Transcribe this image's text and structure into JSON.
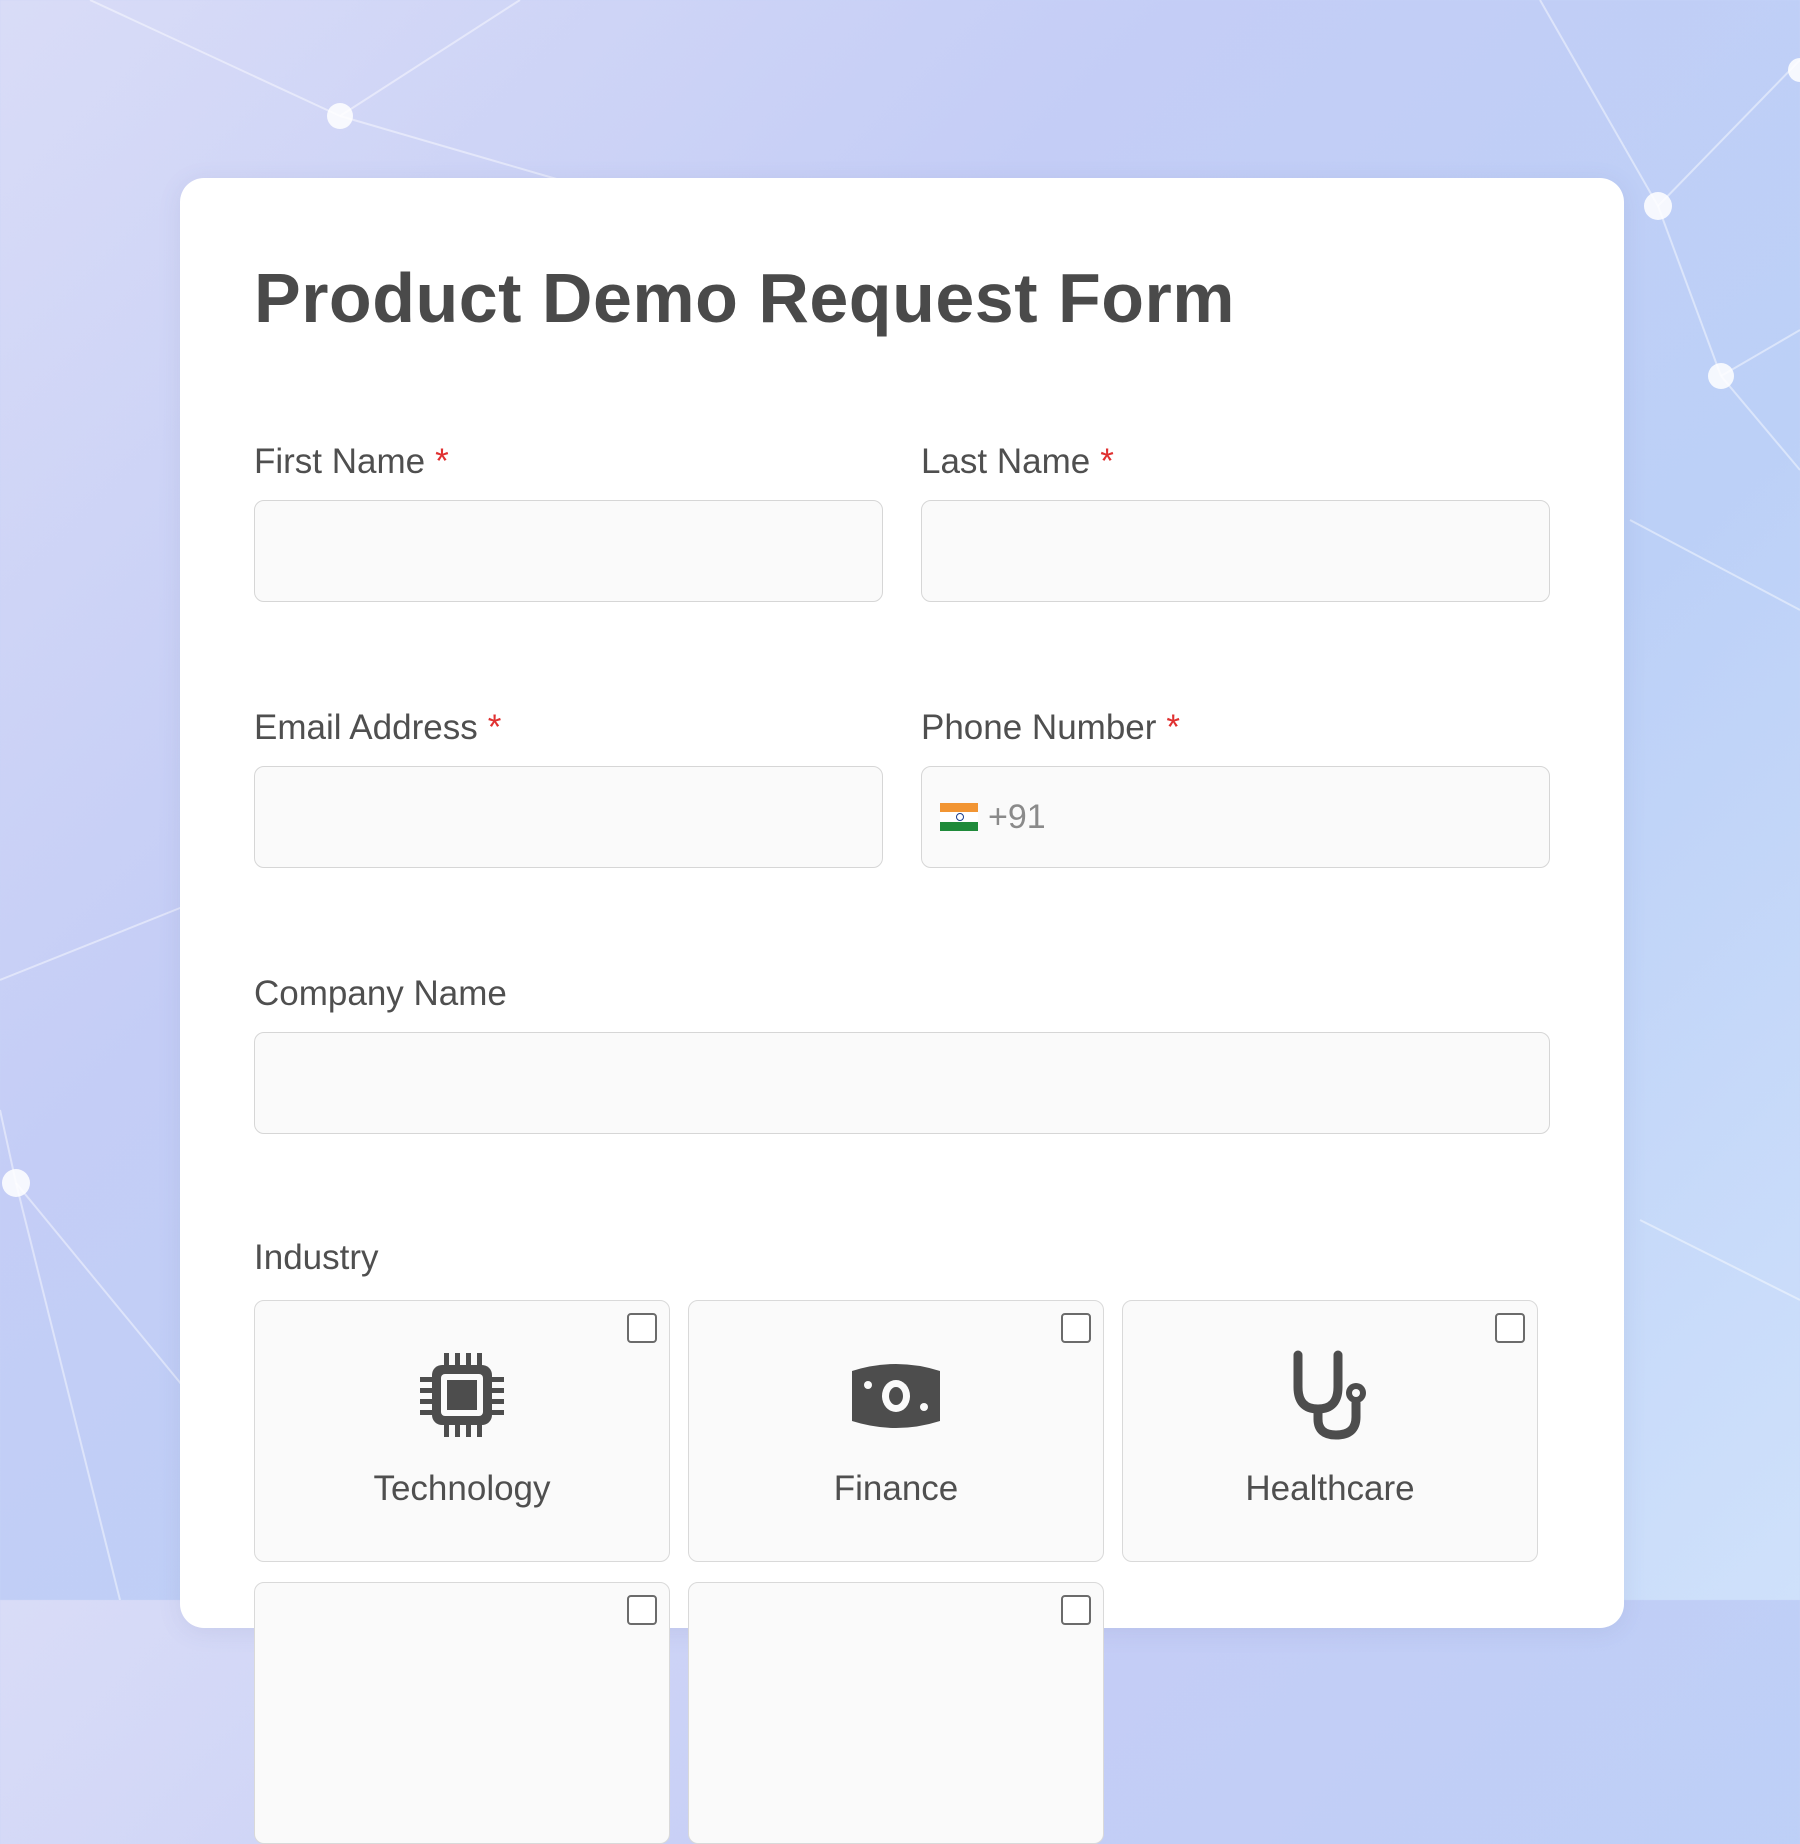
{
  "form": {
    "title": "Product Demo Request Form",
    "required_mark": "*",
    "fields": {
      "first_name": {
        "label": "First Name",
        "value": ""
      },
      "last_name": {
        "label": "Last Name",
        "value": ""
      },
      "email": {
        "label": "Email Address",
        "value": ""
      },
      "phone": {
        "label": "Phone Number",
        "country_flag": "india-flag-icon",
        "dial_code": "+91",
        "value": ""
      },
      "company": {
        "label": "Company Name",
        "value": ""
      }
    },
    "industry": {
      "label": "Industry",
      "options": [
        {
          "label": "Technology",
          "icon": "chip-icon",
          "checked": false
        },
        {
          "label": "Finance",
          "icon": "money-icon",
          "checked": false
        },
        {
          "label": "Healthcare",
          "icon": "stethoscope-icon",
          "checked": false
        }
      ]
    }
  },
  "colors": {
    "required": "#e03131",
    "text": "#4f4f4f",
    "title": "#4a4a4a",
    "icon": "#4d4d4d"
  }
}
